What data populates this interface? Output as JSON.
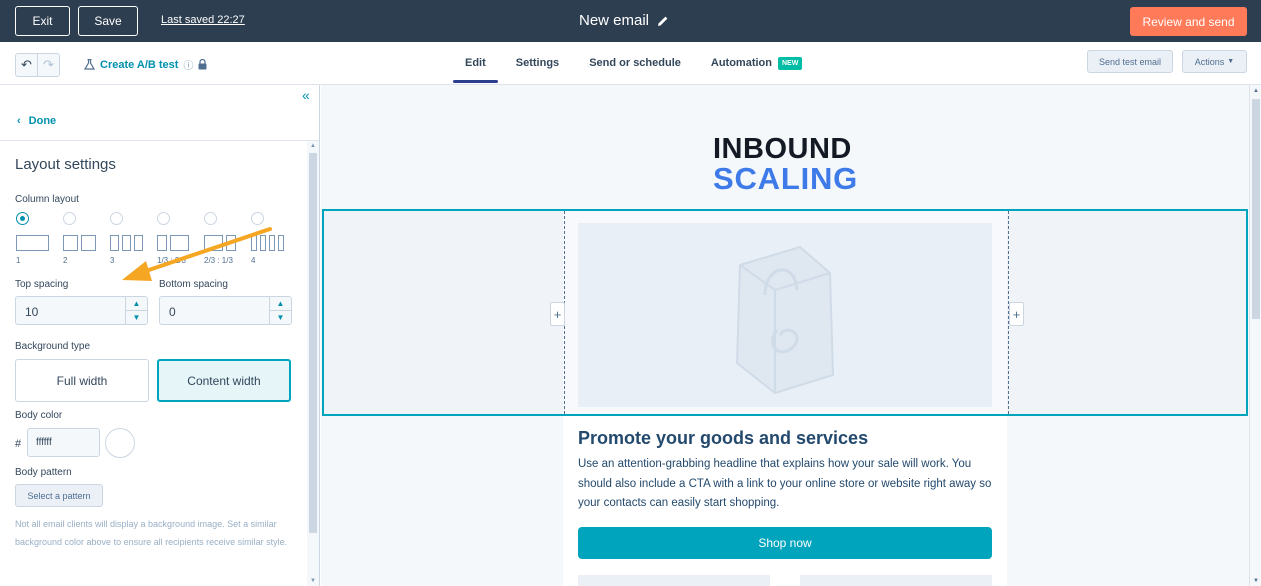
{
  "topbar": {
    "exit_label": "Exit",
    "save_label": "Save",
    "last_saved": "Last saved 22:27",
    "email_title": "New email",
    "review_label": "Review and send"
  },
  "toolbar": {
    "ab_test_label": "Create A/B test",
    "tabs": [
      {
        "label": "Edit",
        "active": true
      },
      {
        "label": "Settings",
        "active": false
      },
      {
        "label": "Send or schedule",
        "active": false
      },
      {
        "label": "Automation",
        "active": false
      }
    ],
    "new_badge": "NEW",
    "send_test_label": "Send test email",
    "actions_label": "Actions"
  },
  "panel": {
    "done_label": "Done",
    "heading": "Layout settings",
    "column_layout_label": "Column layout",
    "layouts": [
      "1",
      "2",
      "3",
      "1/3 : 2/3",
      "2/3 : 1/3",
      "4"
    ],
    "selected_layout": "1",
    "top_spacing_label": "Top spacing",
    "top_spacing_value": "10",
    "bottom_spacing_label": "Bottom spacing",
    "bottom_spacing_value": "0",
    "background_type_label": "Background type",
    "full_width_label": "Full width",
    "content_width_label": "Content width",
    "selected_background": "Content width",
    "body_color_label": "Body color",
    "hash": "#",
    "body_color_value": "ffffff",
    "body_pattern_label": "Body pattern",
    "select_pattern_label": "Select a pattern",
    "note": "Not all email clients will display a background image. Set a similar background color above to ensure all recipients receive similar style."
  },
  "canvas": {
    "logo_line1": "INBOUND",
    "logo_line2": "SCALING",
    "headline": "Promote your goods and services",
    "body_text": "Use an attention-grabbing headline that explains how your sale will work. You should also include a CTA with a link to your online store or website right away so your contacts can easily start shopping.",
    "cta_label": "Shop now",
    "add_column_symbol": "+"
  },
  "colors": {
    "topbar": "#2d3e50",
    "accent_orange": "#ff7a59",
    "accent_teal": "#00a4bd",
    "link": "#0091ae",
    "annotation_arrow": "#f5a623",
    "logo_dark": "#141a24",
    "logo_blue": "#3e7be8"
  },
  "icons": [
    "pencil-icon",
    "undo-icon",
    "redo-icon",
    "flask-icon",
    "info-icon",
    "lock-icon",
    "collapse-panel-icon",
    "chevron-left-icon",
    "caret-down-icon",
    "shopping-bag-icon",
    "annotation-arrow-icon"
  ]
}
